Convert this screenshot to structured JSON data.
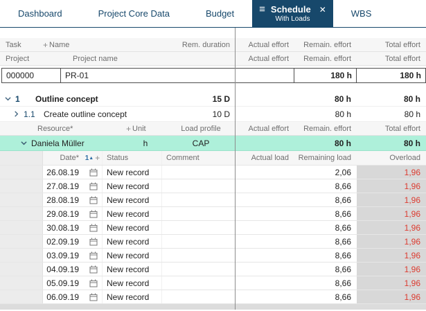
{
  "tabs": {
    "dashboard": "Dashboard",
    "core_data": "Project Core Data",
    "budget": "Budget",
    "schedule": "Schedule",
    "schedule_sub": "With Loads",
    "wbs": "WBS"
  },
  "icons": {
    "menu": "≡",
    "close": "✕",
    "plus": "+",
    "sort_number": "1",
    "sort_dir": "▲"
  },
  "colors": {
    "accent_navy": "#17486b",
    "highlight_teal": "#aef0da",
    "overload_red": "#dc3b30",
    "overload_bg": "#d8d8d8"
  },
  "header1": {
    "task": "Task",
    "name": "Name",
    "rem_duration": "Rem. duration",
    "actual": "Actual effort",
    "remain": "Remain. effort",
    "total": "Total effort"
  },
  "header2": {
    "project": "Project",
    "project_name": "Project name",
    "actual": "Actual effort",
    "remain": "Remain. effort",
    "total": "Total effort"
  },
  "project_row": {
    "id": "000000",
    "name": "PR-01",
    "actual": "",
    "remain": "180 h",
    "total": "180 h"
  },
  "task_rows": [
    {
      "id": "1",
      "name": "Outline concept",
      "duration": "15 D",
      "actual": "",
      "remain": "80 h",
      "total": "80 h"
    },
    {
      "id": "1.1",
      "name": "Create outline concept",
      "duration": "10 D",
      "actual": "",
      "remain": "80 h",
      "total": "80 h"
    }
  ],
  "resource_header": {
    "resource": "Resource*",
    "unit": "Unit",
    "load_profile": "Load profile",
    "actual": "Actual effort",
    "remain": "Remain. effort",
    "total": "Total effort"
  },
  "resource_row": {
    "name": "Daniela Müller",
    "unit": "h",
    "load_profile": "CAP",
    "actual": "",
    "remain": "80 h",
    "total": "80 h"
  },
  "date_header": {
    "date": "Date*",
    "status": "Status",
    "comment": "Comment",
    "actual": "Actual load",
    "remaining": "Remaining load",
    "overload": "Overload"
  },
  "date_rows": [
    {
      "date": "26.08.19",
      "status": "New record",
      "comment": "",
      "actual": "",
      "remaining": "2,06",
      "overload": "1,96"
    },
    {
      "date": "27.08.19",
      "status": "New record",
      "comment": "",
      "actual": "",
      "remaining": "8,66",
      "overload": "1,96"
    },
    {
      "date": "28.08.19",
      "status": "New record",
      "comment": "",
      "actual": "",
      "remaining": "8,66",
      "overload": "1,96"
    },
    {
      "date": "29.08.19",
      "status": "New record",
      "comment": "",
      "actual": "",
      "remaining": "8,66",
      "overload": "1,96"
    },
    {
      "date": "30.08.19",
      "status": "New record",
      "comment": "",
      "actual": "",
      "remaining": "8,66",
      "overload": "1,96"
    },
    {
      "date": "02.09.19",
      "status": "New record",
      "comment": "",
      "actual": "",
      "remaining": "8,66",
      "overload": "1,96"
    },
    {
      "date": "03.09.19",
      "status": "New record",
      "comment": "",
      "actual": "",
      "remaining": "8,66",
      "overload": "1,96"
    },
    {
      "date": "04.09.19",
      "status": "New record",
      "comment": "",
      "actual": "",
      "remaining": "8,66",
      "overload": "1,96"
    },
    {
      "date": "05.09.19",
      "status": "New record",
      "comment": "",
      "actual": "",
      "remaining": "8,66",
      "overload": "1,96"
    },
    {
      "date": "06.09.19",
      "status": "New record",
      "comment": "",
      "actual": "",
      "remaining": "8,66",
      "overload": "1,96"
    }
  ]
}
